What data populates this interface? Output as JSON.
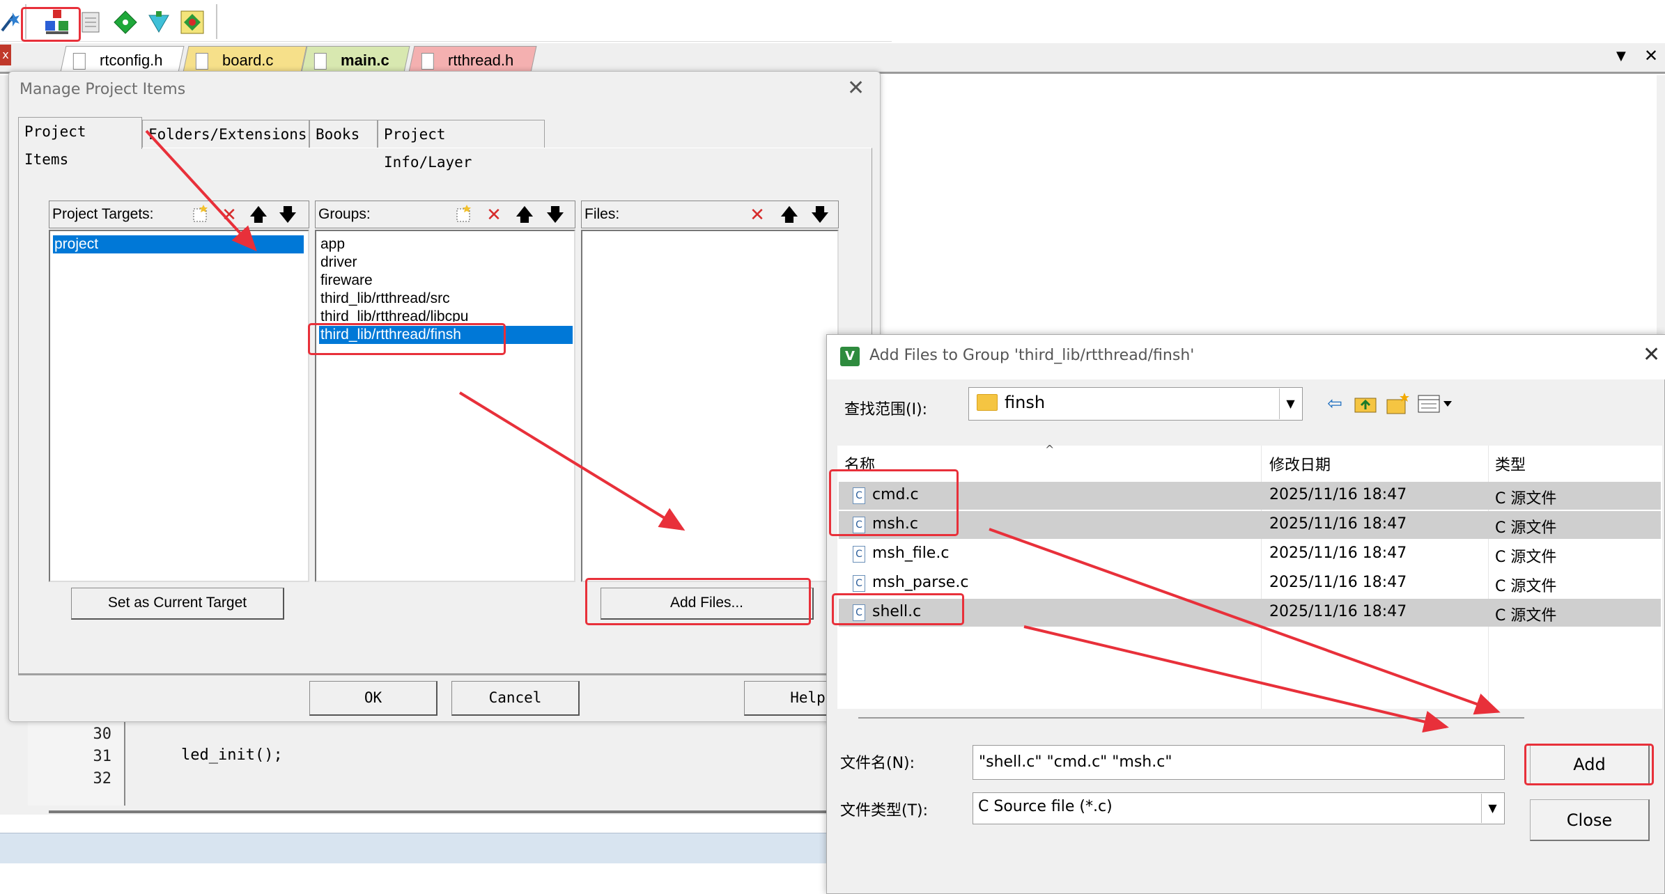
{
  "editor": {
    "file_tabs": [
      "rtconfig.h",
      "board.c",
      "main.c",
      "rtthread.h"
    ],
    "tab_menu_arrow": "▼",
    "tab_close": "✕",
    "line_numbers": [
      "30",
      "31",
      "32"
    ],
    "code_line_31": "led_init();"
  },
  "manage_dialog": {
    "title": "Manage Project Items",
    "close": "✕",
    "tabs": [
      "Project Items",
      "Folders/Extensions",
      "Books",
      "Project Info/Layer"
    ],
    "targets_label": "Project Targets:",
    "targets": [
      "project"
    ],
    "groups_label": "Groups:",
    "groups": [
      "app",
      "driver",
      "fireware",
      "third_lib/rtthread/src",
      "third_lib/rtthread/libcpu",
      "third_lib/rtthread/finsh"
    ],
    "files_label": "Files:",
    "set_current_target": "Set as Current Target",
    "add_files": "Add Files...",
    "ok": "OK",
    "cancel": "Cancel",
    "help": "Help"
  },
  "add_files_dialog": {
    "title": "Add Files to Group 'third_lib/rtthread/finsh'",
    "close": "✕",
    "look_in_label": "查找范围(I):",
    "look_in_value": "finsh",
    "columns": {
      "name": "名称",
      "modified": "修改日期",
      "type": "类型"
    },
    "files": [
      {
        "name": "cmd.c",
        "modified": "2025/11/16 18:47",
        "type": "C 源文件",
        "selected": true
      },
      {
        "name": "msh.c",
        "modified": "2025/11/16 18:47",
        "type": "C 源文件",
        "selected": true
      },
      {
        "name": "msh_file.c",
        "modified": "2025/11/16 18:47",
        "type": "C 源文件",
        "selected": false
      },
      {
        "name": "msh_parse.c",
        "modified": "2025/11/16 18:47",
        "type": "C 源文件",
        "selected": false
      },
      {
        "name": "shell.c",
        "modified": "2025/11/16 18:47",
        "type": "C 源文件",
        "selected": true
      }
    ],
    "file_name_label": "文件名(N):",
    "file_name_value": "\"shell.c\" \"cmd.c\" \"msh.c\"",
    "file_type_label": "文件类型(T):",
    "file_type_value": "C Source file (*.c)",
    "add": "Add",
    "close_button": "Close"
  },
  "colors": {
    "selection": "#0078d7",
    "annotation": "#e8303a",
    "row_selected": "#cfcfcf"
  }
}
